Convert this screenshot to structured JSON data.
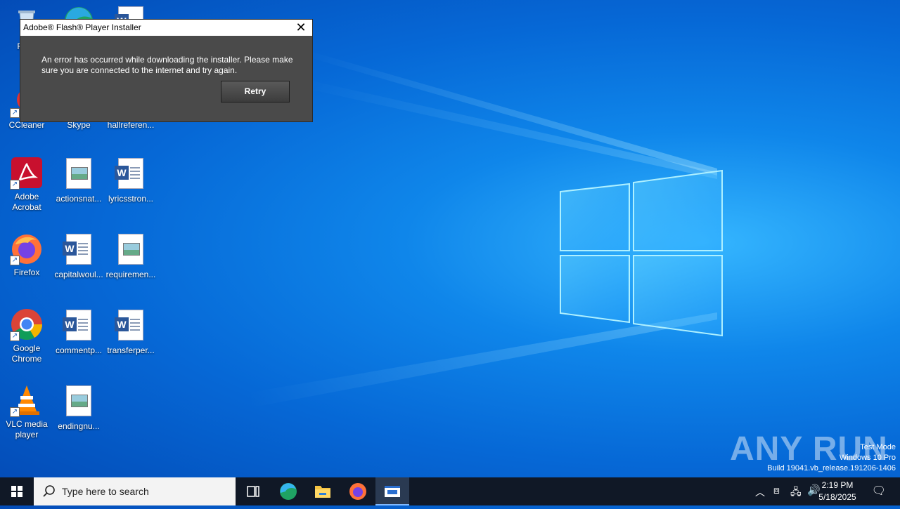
{
  "desktop": {
    "icons": [
      {
        "label": "Recy",
        "icon": "recycle-bin-icon"
      },
      {
        "label": "CCleaner",
        "icon": "ccleaner-icon"
      },
      {
        "label": "Skype",
        "icon": "skype-icon"
      },
      {
        "label": "hallreferen...",
        "icon": "word-doc-icon"
      },
      {
        "label": "Adobe Acrobat",
        "icon": "adobe-acrobat-icon"
      },
      {
        "label": "actionsnat...",
        "icon": "image-file-icon"
      },
      {
        "label": "lyricsstron...",
        "icon": "word-doc-icon"
      },
      {
        "label": "Firefox",
        "icon": "firefox-icon"
      },
      {
        "label": "capitalwoul...",
        "icon": "word-doc-icon"
      },
      {
        "label": "requiremen...",
        "icon": "image-file-icon"
      },
      {
        "label": "Google Chrome",
        "icon": "chrome-icon"
      },
      {
        "label": "commentp...",
        "icon": "word-doc-icon"
      },
      {
        "label": "transferper...",
        "icon": "word-doc-icon"
      },
      {
        "label": "VLC media player",
        "icon": "vlc-icon"
      },
      {
        "label": "endingnu...",
        "icon": "image-file-icon"
      }
    ]
  },
  "dialog": {
    "title": "Adobe® Flash® Player Installer",
    "message": "An error has occurred while downloading the installer. Please make sure you are connected to the internet and try again.",
    "retry_label": "Retry",
    "close_icon": "close-icon"
  },
  "watermark": {
    "brand": "ANY RUN",
    "line1": "Test Mode",
    "line2": "Windows 10 Pro",
    "line3": "Build 19041.vb_release.191206-1406"
  },
  "taskbar": {
    "search_placeholder": "Type here to search",
    "time": "2:19 PM",
    "date": "5/18/2025",
    "apps": [
      "task-view-icon",
      "edge-icon",
      "file-explorer-icon",
      "firefox-icon",
      "flash-installer-icon"
    ]
  },
  "colors": {
    "desktop_blue": "#0f86ea",
    "taskbar": "#101826",
    "dialog_bg": "#4a4a4a"
  }
}
